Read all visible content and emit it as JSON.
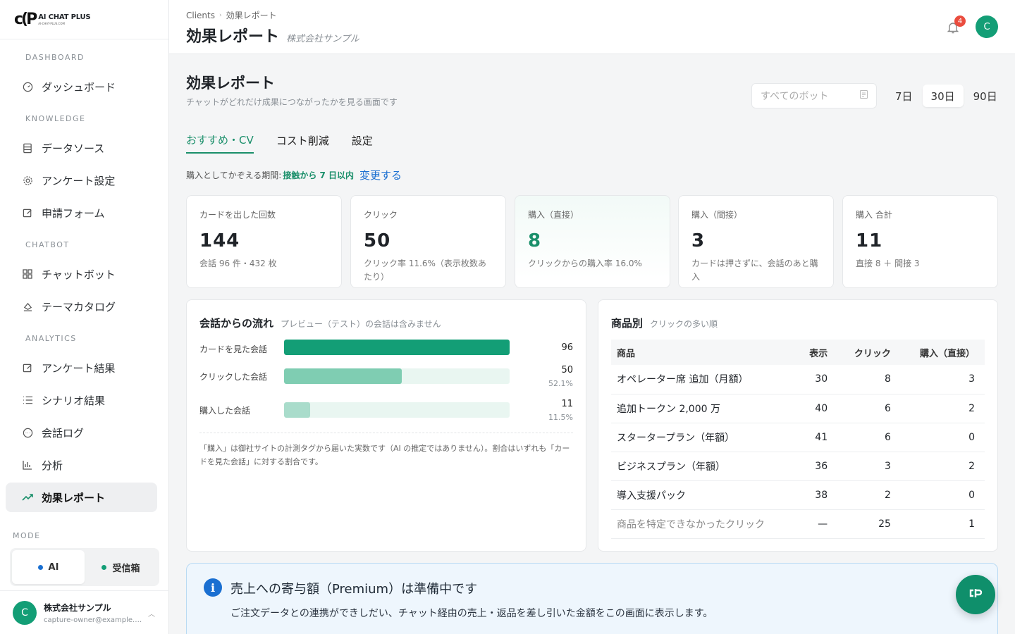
{
  "logo": {
    "mark": "c(P",
    "name": "AI CHAT ",
    "name_bold": "PLUS",
    "sub": "AI-CHAT-PLUS.COM"
  },
  "sidebar": {
    "sections": [
      {
        "label": "DASHBOARD"
      },
      {
        "label": "KNOWLEDGE"
      },
      {
        "label": "CHATBOT"
      },
      {
        "label": "ANALYTICS"
      }
    ],
    "items": [
      {
        "label": "ダッシュボード",
        "icon": "gauge-icon"
      },
      {
        "label": "データソース",
        "icon": "database-icon"
      },
      {
        "label": "アンケート設定",
        "icon": "gear-icon"
      },
      {
        "label": "申請フォーム",
        "icon": "edit-icon"
      },
      {
        "label": "チャットボット",
        "icon": "grid-icon"
      },
      {
        "label": "テーマカタログ",
        "icon": "paint-icon"
      },
      {
        "label": "アンケート結果",
        "icon": "edit-icon"
      },
      {
        "label": "シナリオ結果",
        "icon": "list-icon"
      },
      {
        "label": "会話ログ",
        "icon": "chat-icon"
      },
      {
        "label": "分析",
        "icon": "bar-chart-icon"
      },
      {
        "label": "効果レポート",
        "icon": "trend-icon"
      }
    ],
    "mode_label": "MODE",
    "mode_options": [
      {
        "label": "AI",
        "color": "#1a6fd1"
      },
      {
        "label": "受信箱",
        "color": "#139e76"
      }
    ],
    "user": {
      "initial": "C",
      "name": "株式会社サンプル",
      "email": "capture-owner@example.c..."
    }
  },
  "header": {
    "breadcrumb": [
      "Clients",
      "効果レポート"
    ],
    "title": "効果レポート",
    "subtitle": "株式会社サンプル",
    "notification_count": "4",
    "avatar_initial": "C"
  },
  "main": {
    "title": "効果レポート",
    "description": "チャットがどれだけ成果につながったかを見る画面です",
    "bot_select_placeholder": "すべてのボット",
    "ranges": [
      "7日",
      "30日",
      "90日"
    ],
    "tabs": [
      "おすすめ・CV",
      "コスト削減",
      "設定"
    ],
    "period_label": "購入としてかぞえる期間:",
    "period_value": "接触から 7 日以内",
    "period_link": "変更する",
    "cards": [
      {
        "label": "カードを出した回数",
        "value": "144",
        "note": "会話 96 件・432 枚"
      },
      {
        "label": "クリック",
        "value": "50",
        "note": "クリック率 11.6%（表示枚数あたり）"
      },
      {
        "label": "購入（直接）",
        "value": "8",
        "note": "クリックからの購入率 16.0%"
      },
      {
        "label": "購入（間接）",
        "value": "3",
        "note": "カードは押さずに、会話のあと購入"
      },
      {
        "label": "購入 合計",
        "value": "11",
        "note": "直接 8 ＋ 間接 3"
      }
    ],
    "flow": {
      "title": "会話からの流れ",
      "subtitle": "プレビュー（テスト）の会話は含みません",
      "rows": [
        {
          "label": "カードを見た会話",
          "count": "96",
          "pct": "",
          "ratio": 1.0,
          "color": "#139e76"
        },
        {
          "label": "クリックした会話",
          "count": "50",
          "pct": "52.1%",
          "ratio": 0.521,
          "color": "#7fcdb2"
        },
        {
          "label": "購入した会話",
          "count": "11",
          "pct": "11.5%",
          "ratio": 0.115,
          "color": "#a9dccb"
        }
      ],
      "note": "「購入」は御社サイトの計測タグから届いた実数です（AI の推定ではありません）。割合はいずれも「カードを見た会話」に対する割合です。"
    },
    "products": {
      "title": "商品別",
      "subtitle": "クリックの多い順",
      "headers": [
        "商品",
        "表示",
        "クリック",
        "購入（直接）"
      ],
      "rows": [
        [
          "オペレーター席 追加（月額）",
          "30",
          "8",
          "3"
        ],
        [
          "追加トークン 2,000 万",
          "40",
          "6",
          "2"
        ],
        [
          "スタータープラン（年額）",
          "41",
          "6",
          "0"
        ],
        [
          "ビジネスプラン（年額）",
          "36",
          "3",
          "2"
        ],
        [
          "導入支援パック",
          "38",
          "2",
          "0"
        ],
        [
          "商品を特定できなかったクリック",
          "—",
          "25",
          "1"
        ]
      ]
    },
    "notice": {
      "title": "売上への寄与額（Premium）は準備中です",
      "text": "ご注文データとの連携ができしだい、チャット経由の売上・返品を差し引いた金額をこの画面に表示します。"
    }
  }
}
